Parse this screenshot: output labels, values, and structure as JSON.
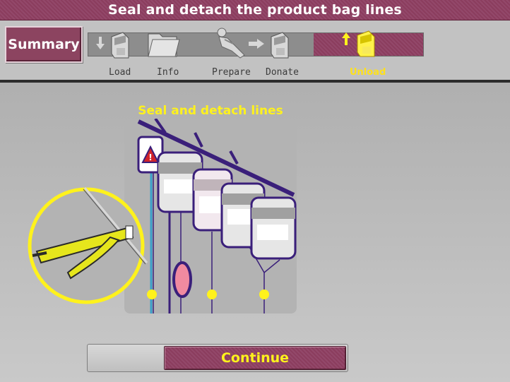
{
  "title": "Seal and detach the product bag lines",
  "summary_button": "Summary",
  "steps": [
    {
      "label": "Load"
    },
    {
      "label": "Info"
    },
    {
      "label": "Prepare"
    },
    {
      "label": "Donate"
    },
    {
      "label": "Unload",
      "active": true
    }
  ],
  "illustration": {
    "title": "Seal and detach lines"
  },
  "continue_button": "Continue",
  "colors": {
    "accent": "#8b3d5e",
    "highlight": "#fff21c",
    "tubing": "#3a1f7a"
  }
}
